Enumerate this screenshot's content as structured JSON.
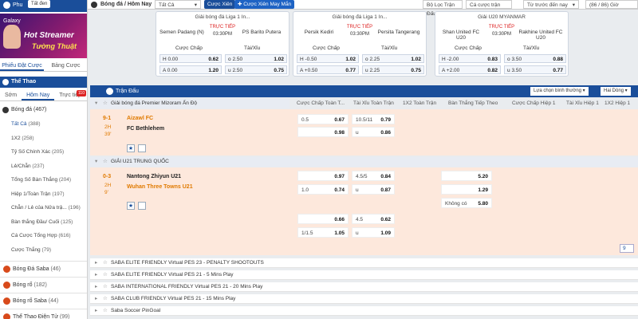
{
  "sidebar": {
    "top_label": "Phu",
    "top_badge": "Tất đen",
    "galaxy": "Galaxy",
    "banner_line1": "Hot Streamer",
    "banner_line2": "Tường Thuật",
    "tab_bets": "Phiếu Đặt Cược",
    "tab_history": "Bảng Cược",
    "sport": "Thể Thao",
    "sub_early": "Sớm",
    "sub_today": "Hôm Nay",
    "sub_live": "Trực tiếp",
    "sub_live_badge": "110",
    "football": "Bóng đá",
    "football_count": "(467)",
    "nav": [
      {
        "label": "Tất Cả",
        "count": "(388)"
      },
      {
        "label": "1X2",
        "count": "(258)"
      },
      {
        "label": "Tỷ Số Chính Xác",
        "count": "(205)"
      },
      {
        "label": "Lẻ/Chẵn",
        "count": "(237)"
      },
      {
        "label": "Tổng Số Bàn Thắng",
        "count": "(204)"
      },
      {
        "label": "Hiệp 1/Toàn Trận",
        "count": "(197)"
      },
      {
        "label": "Chẵn / Lẻ của Nửa trậ...",
        "count": "(196)"
      },
      {
        "label": "Bàn thắng Đầu/ Cuối",
        "count": "(125)"
      },
      {
        "label": "Cá Cược Tổng Hợp",
        "count": "(616)"
      },
      {
        "label": "Cược Thắng",
        "count": "(79)"
      }
    ],
    "sports": [
      {
        "label": "Bóng Đá Saba",
        "count": "(46)"
      },
      {
        "label": "Bóng rổ",
        "count": "(182)"
      },
      {
        "label": "Bóng rổ Saba",
        "count": "(44)"
      },
      {
        "label": "Thể Thao Điện Tử",
        "count": "(99)"
      }
    ]
  },
  "topbar": {
    "breadcrumb": "Bóng đá / Hôm Nay",
    "filter": "Tất Cả",
    "parlay": "Cược Xiên",
    "lucky_parlay": "Cược Xiên May Mắn",
    "filter_matches": "Bộ Lọc Trận Đấu",
    "sort": "Cá cược trận đấu",
    "time": "Từ trước đến nay",
    "count": "(86 / 86)",
    "gio": "Giờ"
  },
  "cards": [
    {
      "league": "Giải bóng đá Liga 1 In...",
      "home": "Semen Padang (N)",
      "away": "PS Barito Putera",
      "live": "TRỰC TIẾP",
      "time": "03:30PM",
      "h_label": "H",
      "a_label": "A",
      "hcap": [
        "0.00",
        "0.00"
      ],
      "hcap_odds": [
        "0.62",
        "1.20"
      ],
      "ou_label": [
        "o",
        "u"
      ],
      "ou": [
        "2.50",
        "2.50"
      ],
      "ou_odds": [
        "1.02",
        "0.75"
      ]
    },
    {
      "league": "Giải bóng đá Liga 1 In...",
      "home": "Persik Kediri",
      "away": "Persita Tangerang",
      "live": "TRỰC TIẾP",
      "time": "03:30PM",
      "h_label": "H",
      "a_label": "A",
      "hcap": [
        "-0.50",
        "+0.50"
      ],
      "hcap_odds": [
        "1.02",
        "0.77"
      ],
      "ou_label": [
        "o",
        "u"
      ],
      "ou": [
        "2.25",
        "2.25"
      ],
      "ou_odds": [
        "1.02",
        "0.75"
      ]
    },
    {
      "league": "Giải U20 MYANMAR",
      "home": "Shan United FC U20",
      "away": "Rakhine United FC U20",
      "live": "TRỰC TIẾP",
      "time": "03:30PM",
      "h_label": "H",
      "a_label": "A",
      "hcap": [
        "-2.00",
        "+2.00"
      ],
      "hcap_odds": [
        "0.83",
        "0.82"
      ],
      "ou_label": [
        "o",
        "u"
      ],
      "ou": [
        "3.50",
        "3.50"
      ],
      "ou_odds": [
        "0.88",
        "0.77"
      ]
    }
  ],
  "card_headers": {
    "hcap": "Cược Chấp",
    "ou": "Tài/Xỉu"
  },
  "main": {
    "title": "Trận Đấu",
    "odds_type": "Lựa chọn bình thường",
    "odds_fmt": "Hai Dòng",
    "cols": [
      "Cược Chấp Toàn T...",
      "Tài Xỉu Toàn Trận",
      "1X2 Toàn Trận",
      "Bàn Thắng Tiếp Theo",
      "Cược Chấp Hiệp 1",
      "Tài Xỉu Hiệp 1",
      "1X2 Hiệp 1"
    ]
  },
  "leagues": [
    {
      "name": "Giải bóng đá Premier Mizoram Ấn Độ",
      "score": "9-1",
      "period": "2H",
      "minute": "39'",
      "home": "Aizawl FC",
      "away": "FC Bethlehem",
      "hcap_line": "0.5",
      "hcap_odds": [
        "0.67",
        "0.98"
      ],
      "ou_line": "10.5/11",
      "ou_label": "u",
      "ou_odds": [
        "0.79",
        "0.86"
      ]
    },
    {
      "name": "GIẢI U21 TRUNG QUỐC",
      "score": "0-3",
      "period": "2H",
      "minute": "9'",
      "home": "Nantong Zhiyun U21",
      "away": "Wuhan Three Towns U21",
      "hcap_line": "1.0",
      "hcap_odds": [
        "0.97",
        "0.74"
      ],
      "ou_line": "4.5/5",
      "ou_label": "u",
      "ou_odds": [
        "0.84",
        "0.87"
      ],
      "next_goal": [
        "5.20",
        "1.29",
        "5.80"
      ],
      "no_goal": "Không có",
      "hcap2_line": "1/1.5",
      "hcap2_odds": [
        "0.66",
        "1.05"
      ],
      "ou2_line": "4.5",
      "ou2_odds": [
        "0.62",
        "1.09"
      ],
      "more": "9"
    }
  ],
  "saba": [
    "SABA ELITE FRIENDLY Virtual PES 23 - PENALTY SHOOTOUTS",
    "SABA ELITE FRIENDLY Virtual PES 21 - 5 Mins Play",
    "SABA INTERNATIONAL FRIENDLY Virtual PES 21 - 20 Mins Play",
    "SABA CLUB FRIENDLY Virtual PES 21 - 15 Mins Play",
    "Saba Soccer PinGoal"
  ],
  "colors": {
    "brand": "#1a4e9a",
    "live": "#dd2222",
    "match_bg": "#fde8dc",
    "home_team": "#e07a00"
  }
}
